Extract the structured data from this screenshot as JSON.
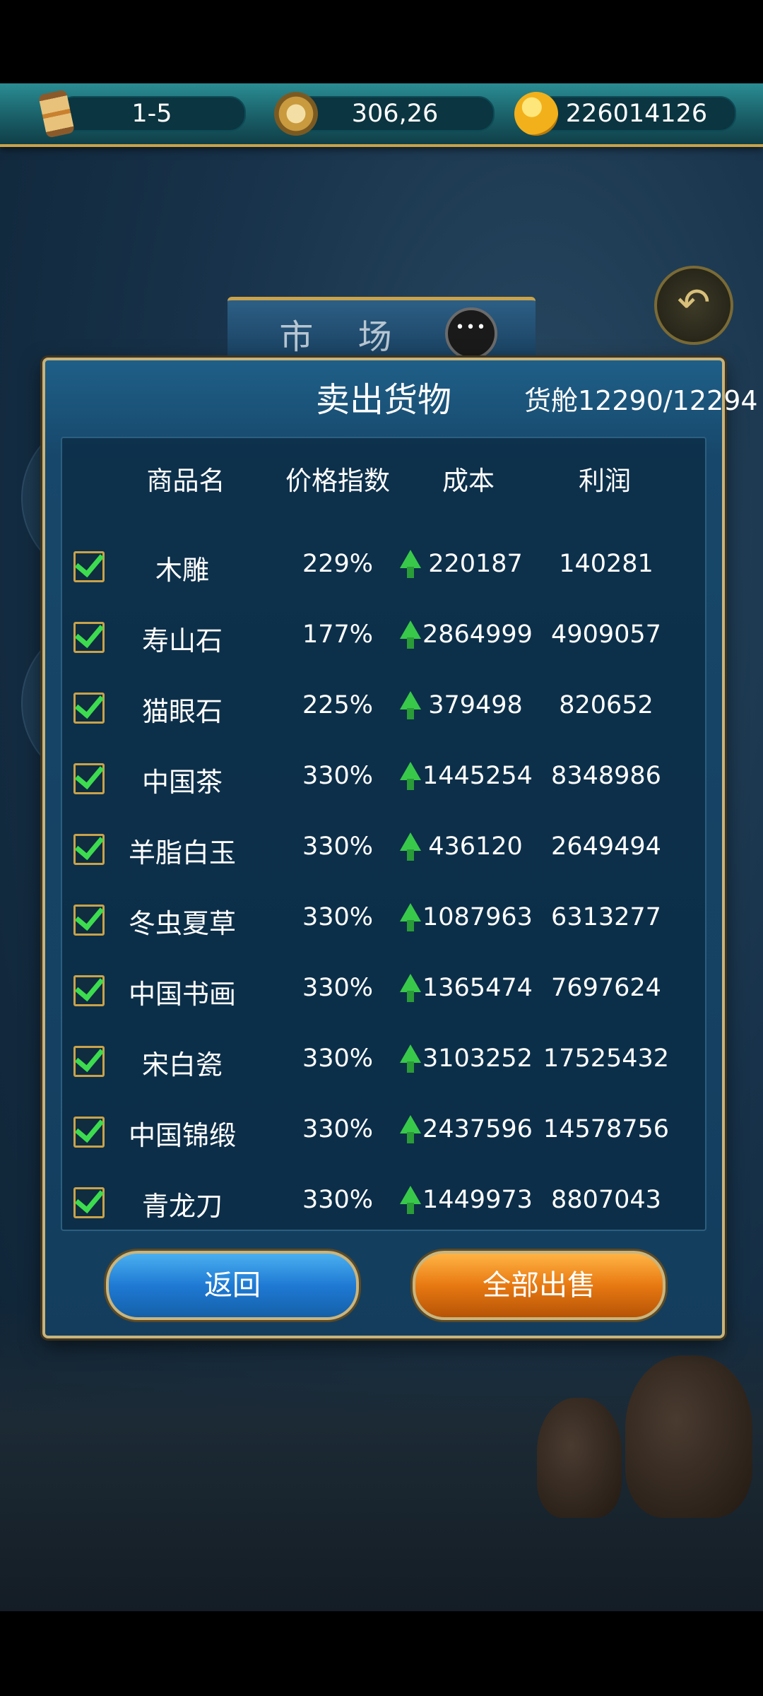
{
  "topbar": {
    "voyage": "1-5",
    "position": "306,26",
    "gold": "226014126",
    "icons": [
      "hourglass-icon",
      "compass-icon",
      "gold-coin-icon"
    ]
  },
  "market": {
    "title": "市 场",
    "chat_icon": "chat-bubble-icon"
  },
  "back_icon": "return-arrow-icon",
  "dialog": {
    "title": "卖出货物",
    "cargo": "货舱12290/12294",
    "headers": [
      "商品名",
      "价格指数",
      "成本",
      "利润"
    ],
    "rows": [
      {
        "name": "木雕",
        "index": "229%",
        "cost": "220187",
        "profit": "140281"
      },
      {
        "name": "寿山石",
        "index": "177%",
        "cost": "2864999",
        "profit": "4909057"
      },
      {
        "name": "猫眼石",
        "index": "225%",
        "cost": "379498",
        "profit": "820652"
      },
      {
        "name": "中国茶",
        "index": "330%",
        "cost": "1445254",
        "profit": "8348986"
      },
      {
        "name": "羊脂白玉",
        "index": "330%",
        "cost": "436120",
        "profit": "2649494"
      },
      {
        "name": "冬虫夏草",
        "index": "330%",
        "cost": "1087963",
        "profit": "6313277"
      },
      {
        "name": "中国书画",
        "index": "330%",
        "cost": "1365474",
        "profit": "7697624"
      },
      {
        "name": "宋白瓷",
        "index": "330%",
        "cost": "3103252",
        "profit": "17525432"
      },
      {
        "name": "中国锦缎",
        "index": "330%",
        "cost": "2437596",
        "profit": "14578756"
      },
      {
        "name": "青龙刀",
        "index": "330%",
        "cost": "1449973",
        "profit": "8807043"
      }
    ],
    "buttons": {
      "back": "返回",
      "sell_all": "全部出售"
    }
  },
  "colors": {
    "check": "#3ddc4f",
    "arrow_up": "#39c94a",
    "accent_gold": "#c9a24a",
    "back_button": "#1f7ad4",
    "sell_button": "#e87912"
  }
}
